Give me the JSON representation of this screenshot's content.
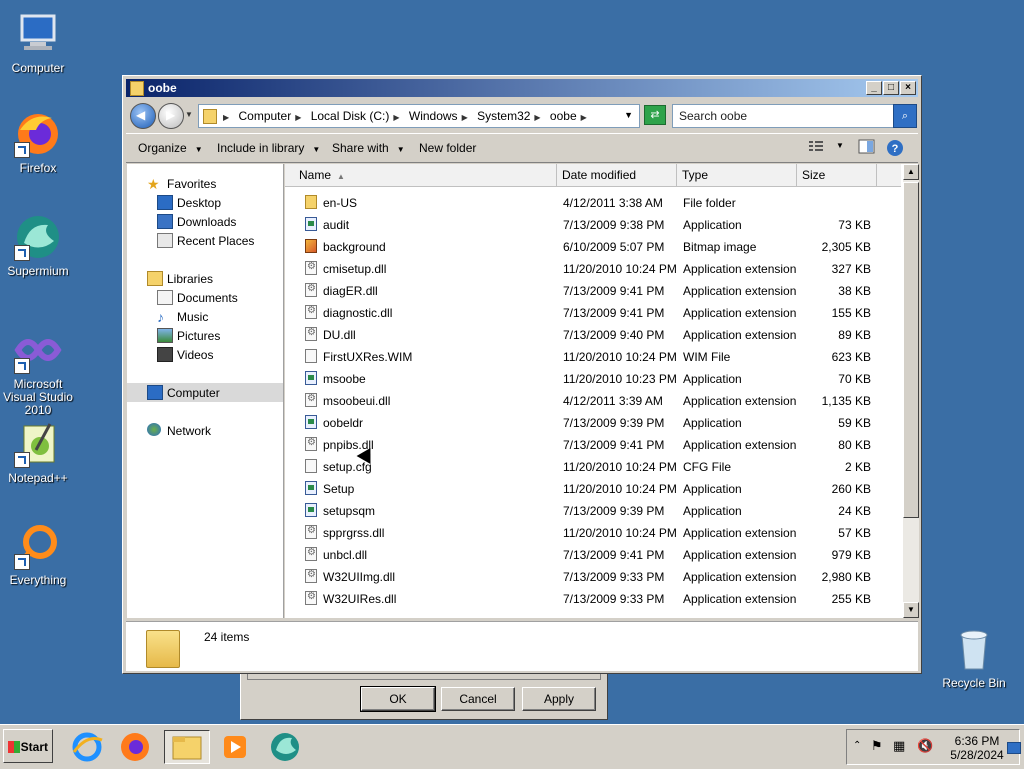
{
  "desktop": {
    "icons": [
      {
        "label": "Computer"
      },
      {
        "label": "Firefox"
      },
      {
        "label": "Supermium"
      },
      {
        "label": "Microsoft Visual Studio 2010"
      },
      {
        "label": "Notepad++"
      },
      {
        "label": "Everything"
      },
      {
        "label": "Recycle Bin"
      }
    ]
  },
  "bg_dialog": {
    "ok": "OK",
    "cancel": "Cancel",
    "apply": "Apply"
  },
  "window": {
    "title": "oobe",
    "breadcrumbs": [
      "Computer",
      "Local Disk (C:)",
      "Windows",
      "System32",
      "oobe"
    ],
    "search_placeholder": "Search oobe",
    "toolbar": {
      "organize": "Organize",
      "include": "Include in library",
      "share": "Share with",
      "new_folder": "New folder"
    },
    "nav": {
      "favorites": "Favorites",
      "desktop": "Desktop",
      "downloads": "Downloads",
      "recent": "Recent Places",
      "libraries": "Libraries",
      "documents": "Documents",
      "music": "Music",
      "pictures": "Pictures",
      "videos": "Videos",
      "computer": "Computer",
      "network": "Network"
    },
    "columns": {
      "name": "Name",
      "date": "Date modified",
      "type": "Type",
      "size": "Size"
    },
    "files": [
      {
        "name": "en-US",
        "date": "4/12/2011 3:38 AM",
        "type": "File folder",
        "size": "",
        "icon": "folder"
      },
      {
        "name": "audit",
        "date": "7/13/2009 9:38 PM",
        "type": "Application",
        "size": "73 KB",
        "icon": "app"
      },
      {
        "name": "background",
        "date": "6/10/2009 5:07 PM",
        "type": "Bitmap image",
        "size": "2,305 KB",
        "icon": "image"
      },
      {
        "name": "cmisetup.dll",
        "date": "11/20/2010 10:24 PM",
        "type": "Application extension",
        "size": "327 KB",
        "icon": "dll"
      },
      {
        "name": "diagER.dll",
        "date": "7/13/2009 9:41 PM",
        "type": "Application extension",
        "size": "38 KB",
        "icon": "dll"
      },
      {
        "name": "diagnostic.dll",
        "date": "7/13/2009 9:41 PM",
        "type": "Application extension",
        "size": "155 KB",
        "icon": "dll"
      },
      {
        "name": "DU.dll",
        "date": "7/13/2009 9:40 PM",
        "type": "Application extension",
        "size": "89 KB",
        "icon": "dll"
      },
      {
        "name": "FirstUXRes.WIM",
        "date": "11/20/2010 10:24 PM",
        "type": "WIM File",
        "size": "623 KB",
        "icon": "file"
      },
      {
        "name": "msoobe",
        "date": "11/20/2010 10:23 PM",
        "type": "Application",
        "size": "70 KB",
        "icon": "app"
      },
      {
        "name": "msoobeui.dll",
        "date": "4/12/2011 3:39 AM",
        "type": "Application extension",
        "size": "1,135 KB",
        "icon": "dll"
      },
      {
        "name": "oobeldr",
        "date": "7/13/2009 9:39 PM",
        "type": "Application",
        "size": "59 KB",
        "icon": "app"
      },
      {
        "name": "pnpibs.dll",
        "date": "7/13/2009 9:41 PM",
        "type": "Application extension",
        "size": "80 KB",
        "icon": "dll"
      },
      {
        "name": "setup.cfg",
        "date": "11/20/2010 10:24 PM",
        "type": "CFG File",
        "size": "2 KB",
        "icon": "file"
      },
      {
        "name": "Setup",
        "date": "11/20/2010 10:24 PM",
        "type": "Application",
        "size": "260 KB",
        "icon": "app"
      },
      {
        "name": "setupsqm",
        "date": "7/13/2009 9:39 PM",
        "type": "Application",
        "size": "24 KB",
        "icon": "app"
      },
      {
        "name": "spprgrss.dll",
        "date": "11/20/2010 10:24 PM",
        "type": "Application extension",
        "size": "57 KB",
        "icon": "dll"
      },
      {
        "name": "unbcl.dll",
        "date": "7/13/2009 9:41 PM",
        "type": "Application extension",
        "size": "979 KB",
        "icon": "dll"
      },
      {
        "name": "W32UIImg.dll",
        "date": "7/13/2009 9:33 PM",
        "type": "Application extension",
        "size": "2,980 KB",
        "icon": "dll"
      },
      {
        "name": "W32UIRes.dll",
        "date": "7/13/2009 9:33 PM",
        "type": "Application extension",
        "size": "255 KB",
        "icon": "dll"
      }
    ],
    "status": "24 items"
  },
  "taskbar": {
    "start": "Start",
    "time": "6:36 PM",
    "date": "5/28/2024"
  }
}
